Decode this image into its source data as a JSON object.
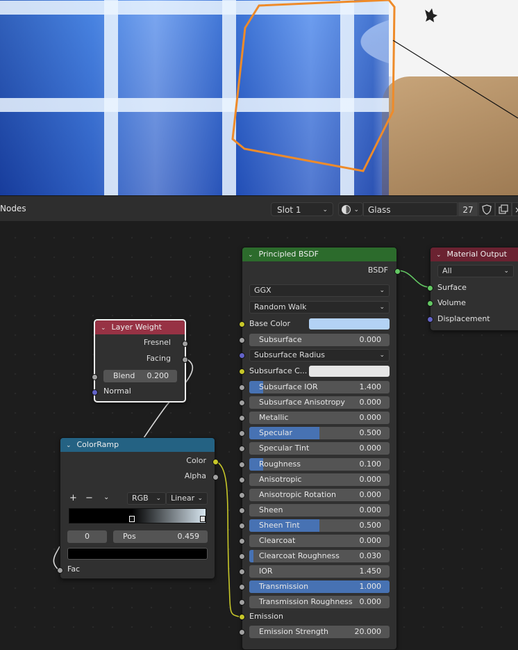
{
  "editor": {
    "title": "Nodes",
    "slot": "Slot 1",
    "material_name": "Glass",
    "user_count": "27"
  },
  "colors": {
    "principled_header": "#2c6b2c",
    "output_header": "#6b2231",
    "layer_weight_header": "#973244",
    "colorramp_header": "#246283",
    "value_fill": "#4772b3",
    "selection_outline": "#ee8b2a"
  },
  "icons": [
    "chevron-down-icon",
    "material-sphere-icon",
    "shield-icon",
    "copy-icon",
    "close-icon",
    "plus-icon",
    "minus-icon"
  ],
  "layer_weight": {
    "title": "Layer Weight",
    "out_fresnel": "Fresnel",
    "out_facing": "Facing",
    "blend_label": "Blend",
    "blend_value": "0.200",
    "in_normal": "Normal"
  },
  "colorramp": {
    "title": "ColorRamp",
    "out_color": "Color",
    "out_alpha": "Alpha",
    "plus": "+",
    "minus": "−",
    "mode": "RGB",
    "interp": "Linear",
    "index": "0",
    "pos_label": "Pos",
    "pos_value": "0.459",
    "in_fac": "Fac"
  },
  "principled": {
    "title": "Principled BSDF",
    "out_bsdf": "BSDF",
    "distribution": "GGX",
    "subsurface_method": "Random Walk",
    "base_color_label": "Base Color",
    "base_color": "#b3d2f5",
    "subsurface_radius_label": "Subsurface Radius",
    "subsurface_color_label": "Subsurface C...",
    "subsurface_color": "#e6e6e6",
    "emission_label": "Emission",
    "fields": [
      {
        "label": "Subsurface",
        "value": "0.000",
        "fill": 0.0,
        "socket": "gry"
      },
      {
        "label": "Subsurface IOR",
        "value": "1.400",
        "fill": 0.1,
        "socket": "gry"
      },
      {
        "label": "Subsurface Anisotropy",
        "value": "0.000",
        "fill": 0.0,
        "socket": "gry"
      },
      {
        "label": "Metallic",
        "value": "0.000",
        "fill": 0.0,
        "socket": "gry"
      },
      {
        "label": "Specular",
        "value": "0.500",
        "fill": 0.5,
        "socket": "gry"
      },
      {
        "label": "Specular Tint",
        "value": "0.000",
        "fill": 0.0,
        "socket": "gry"
      },
      {
        "label": "Roughness",
        "value": "0.100",
        "fill": 0.1,
        "socket": "gry"
      },
      {
        "label": "Anisotropic",
        "value": "0.000",
        "fill": 0.0,
        "socket": "gry"
      },
      {
        "label": "Anisotropic Rotation",
        "value": "0.000",
        "fill": 0.0,
        "socket": "gry"
      },
      {
        "label": "Sheen",
        "value": "0.000",
        "fill": 0.0,
        "socket": "gry"
      },
      {
        "label": "Sheen Tint",
        "value": "0.500",
        "fill": 0.5,
        "socket": "gry"
      },
      {
        "label": "Clearcoat",
        "value": "0.000",
        "fill": 0.0,
        "socket": "gry"
      },
      {
        "label": "Clearcoat Roughness",
        "value": "0.030",
        "fill": 0.03,
        "socket": "gry"
      },
      {
        "label": "IOR",
        "value": "1.450",
        "fill": 0.0,
        "socket": "gry"
      },
      {
        "label": "Transmission",
        "value": "1.000",
        "fill": 1.0,
        "socket": "gry"
      },
      {
        "label": "Transmission Roughness",
        "value": "0.000",
        "fill": 0.0,
        "socket": "gry"
      }
    ],
    "emission_strength_label": "Emission Strength",
    "emission_strength_value": "20.000"
  },
  "material_output": {
    "title": "Material Output",
    "target": "All",
    "in_surface": "Surface",
    "in_volume": "Volume",
    "in_displacement": "Displacement"
  }
}
